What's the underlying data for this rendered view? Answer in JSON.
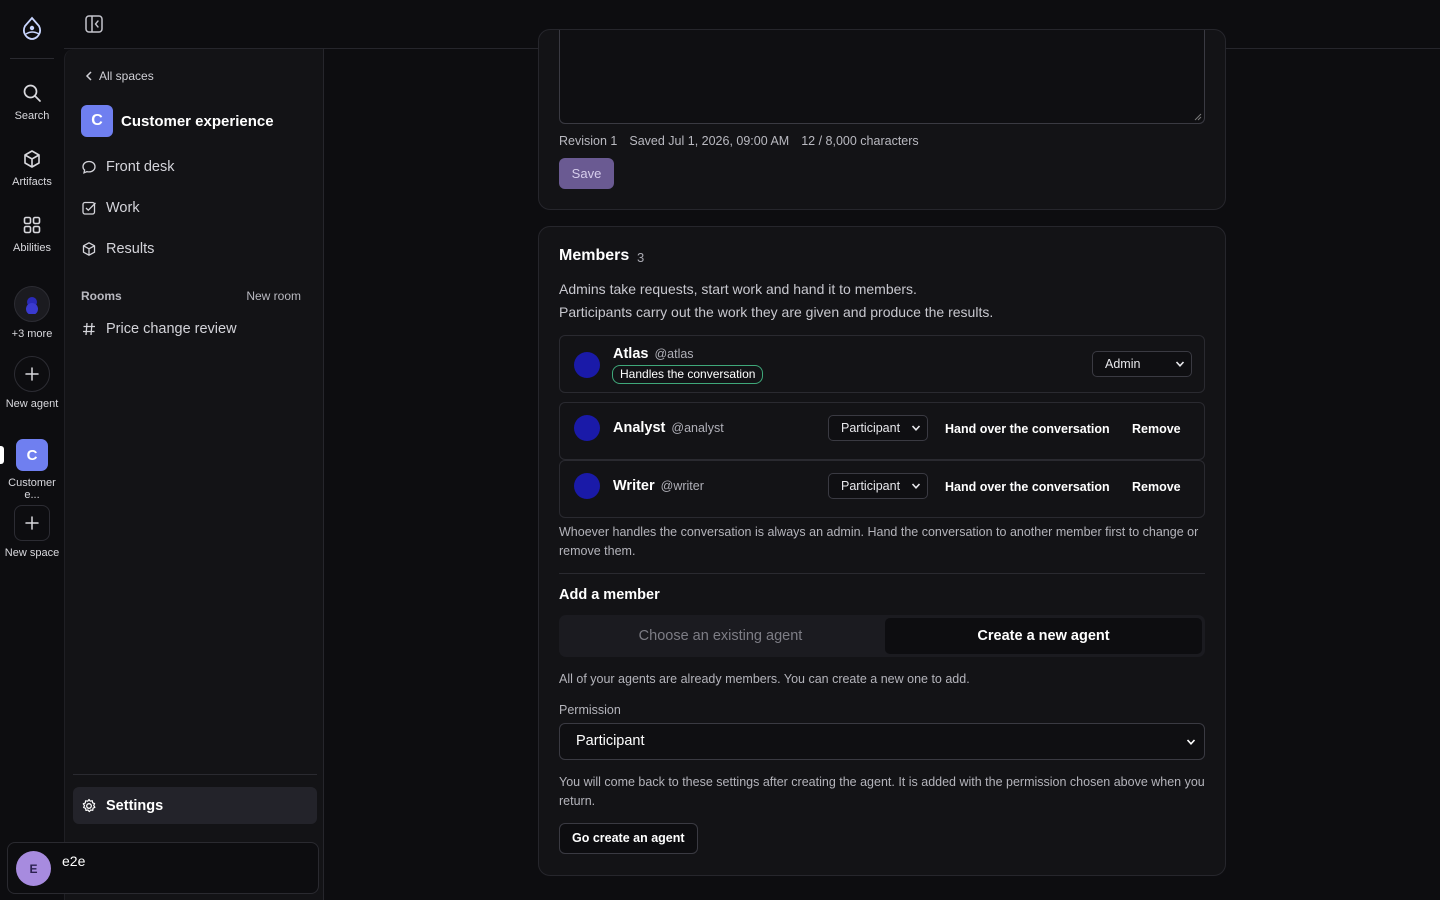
{
  "rail": {
    "items": [
      {
        "label": "Search",
        "icon": "search-icon"
      },
      {
        "label": "Artifacts",
        "icon": "cube-icon"
      },
      {
        "label": "Abilities",
        "icon": "grid-icon"
      }
    ],
    "more_label": "+3 more",
    "new_agent_label": "New agent",
    "space_letter": "C",
    "space_label": "Customer e...",
    "new_space_label": "New space"
  },
  "sidebar": {
    "back_label": "All spaces",
    "space_letter": "C",
    "space_name": "Customer experience",
    "nav": [
      {
        "label": "Front desk",
        "icon": "chat-bubble-icon"
      },
      {
        "label": "Work",
        "icon": "checkbox-icon"
      },
      {
        "label": "Results",
        "icon": "cube-icon"
      }
    ],
    "rooms_label": "Rooms",
    "new_room_label": "New room",
    "rooms": [
      {
        "label": "Price change review"
      }
    ],
    "settings_label": "Settings",
    "user": {
      "initial": "E",
      "name": "e2e"
    }
  },
  "editor": {
    "revision": "Revision 1",
    "saved": "Saved Jul 1, 2026, 09:00 AM",
    "chars": "12 / 8,000 characters",
    "save_label": "Save"
  },
  "members": {
    "title": "Members",
    "count": "3",
    "desc_line1": "Admins take requests, start work and hand it to members.",
    "desc_line2": "Participants carry out the work they are given and produce the results.",
    "list": [
      {
        "name": "Atlas",
        "handle": "@atlas",
        "badge": "Handles the conversation",
        "role": "Admin"
      },
      {
        "name": "Analyst",
        "handle": "@analyst",
        "role": "Participant",
        "handover": "Hand over the conversation",
        "remove": "Remove"
      },
      {
        "name": "Writer",
        "handle": "@writer",
        "role": "Participant",
        "handover": "Hand over the conversation",
        "remove": "Remove"
      }
    ],
    "note": "Whoever handles the conversation is always an admin. Hand the conversation to another member first to change or remove them.",
    "add_title": "Add a member",
    "tab_existing": "Choose an existing agent",
    "tab_new": "Create a new agent",
    "all_members_note": "All of your agents are already members. You can create a new one to add.",
    "permission_label": "Permission",
    "permission_value": "Participant",
    "return_note": "You will come back to these settings after creating the agent. It is added with the permission chosen above when you return.",
    "go_create_label": "Go create an agent"
  },
  "colors": {
    "accent": "#6f7ff0",
    "avatar": "#1a1aa8",
    "badge_border": "#3fa87a",
    "save_button": "#6a5a92"
  }
}
